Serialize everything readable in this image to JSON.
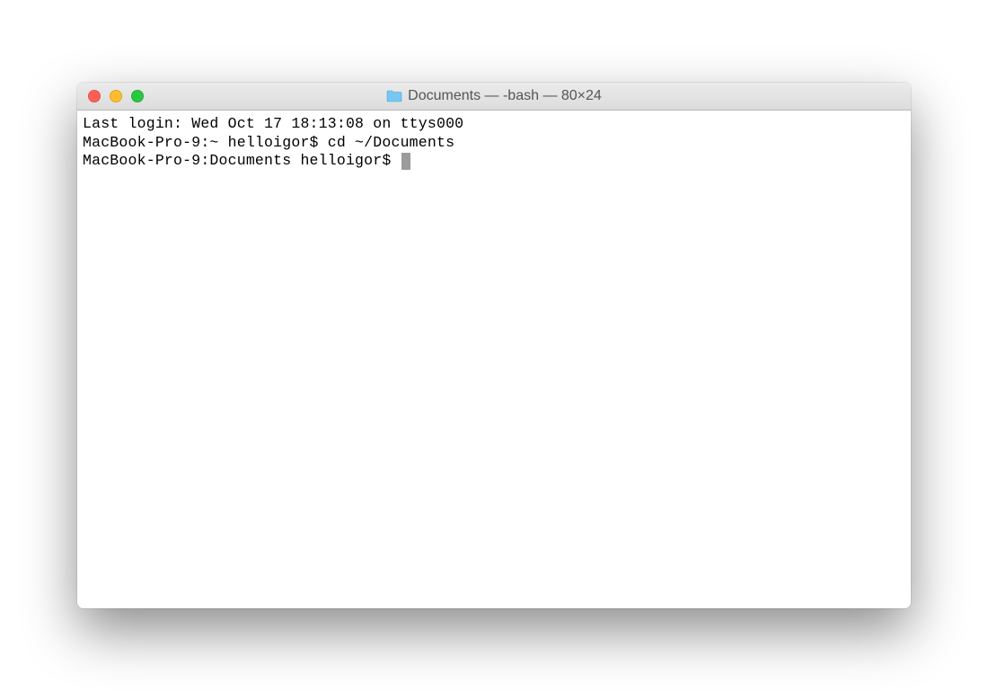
{
  "window": {
    "title": "Documents — -bash — 80×24"
  },
  "traffic_lights": {
    "close": "close",
    "minimize": "minimize",
    "maximize": "maximize"
  },
  "terminal": {
    "line1": "Last login: Wed Oct 17 18:13:08 on ttys000",
    "line2_prompt": "MacBook-Pro-9:~ helloigor$ ",
    "line2_cmd": "cd ~/Documents",
    "line3_prompt": "MacBook-Pro-9:Documents helloigor$ "
  }
}
